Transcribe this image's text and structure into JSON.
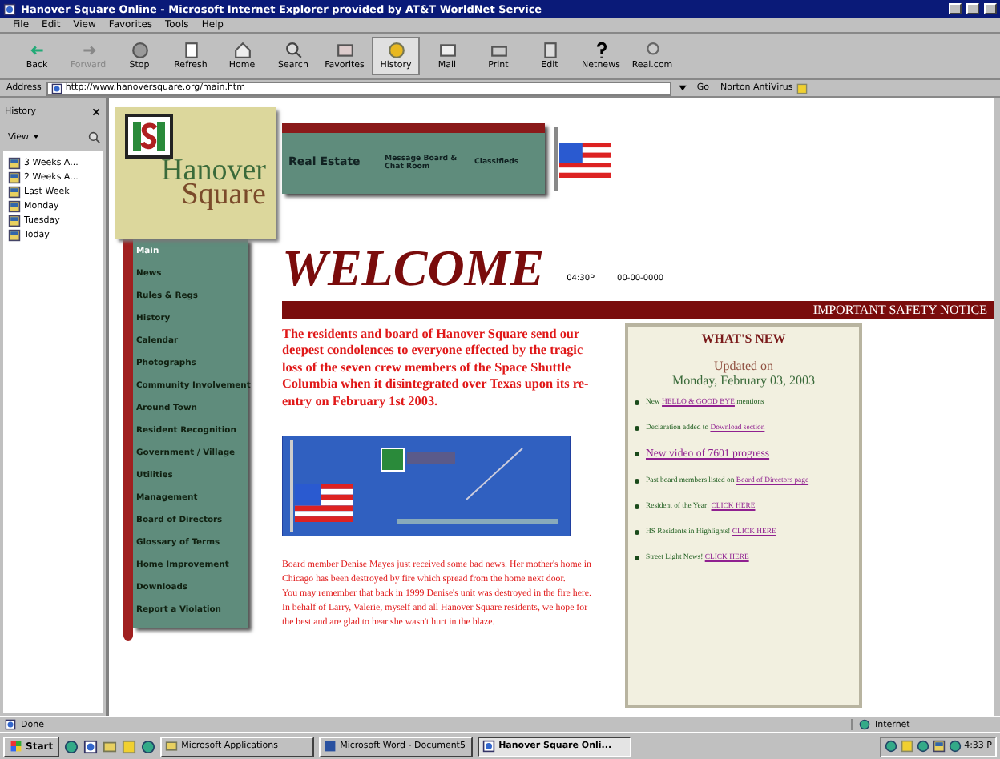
{
  "window": {
    "title": "Hanover Square Online - Microsoft Internet Explorer provided by AT&T WorldNet Service"
  },
  "menu": [
    "File",
    "Edit",
    "View",
    "Favorites",
    "Tools",
    "Help"
  ],
  "toolbar": [
    {
      "label": "Back",
      "kind": "back",
      "disabled": false,
      "selected": false
    },
    {
      "label": "Forward",
      "kind": "forward",
      "disabled": true,
      "selected": false
    },
    {
      "label": "Stop",
      "kind": "stop",
      "disabled": false,
      "selected": false
    },
    {
      "label": "Refresh",
      "kind": "refresh",
      "disabled": false,
      "selected": false
    },
    {
      "label": "Home",
      "kind": "home",
      "disabled": false,
      "selected": false
    },
    {
      "label": "Search",
      "kind": "search",
      "disabled": false,
      "selected": false
    },
    {
      "label": "Favorites",
      "kind": "favorites",
      "disabled": false,
      "selected": false
    },
    {
      "label": "History",
      "kind": "history",
      "disabled": false,
      "selected": true
    },
    {
      "label": "Mail",
      "kind": "mail",
      "disabled": false,
      "selected": false
    },
    {
      "label": "Print",
      "kind": "print",
      "disabled": false,
      "selected": false
    },
    {
      "label": "Edit",
      "kind": "edit",
      "disabled": false,
      "selected": false
    },
    {
      "label": "Netnews",
      "kind": "help",
      "disabled": false,
      "selected": false
    },
    {
      "label": "Real.com",
      "kind": "real",
      "disabled": false,
      "selected": false
    }
  ],
  "address": {
    "label": "Address",
    "value": "http://www.hanoversquare.org/main.htm",
    "go": "Go",
    "norton": "Norton AntiVirus"
  },
  "history_pane": {
    "title": "History",
    "view": "View",
    "items": [
      "3 Weeks A...",
      "2 Weeks A...",
      "Last Week",
      "Monday",
      "Tuesday",
      "Today"
    ]
  },
  "site": {
    "logo_top": "Hanover",
    "logo_bottom": "Square",
    "top_nav": [
      "Real Estate",
      "Message Board & Chat Room",
      "Classifieds"
    ],
    "nav": [
      {
        "label": "Main",
        "selected": true
      },
      {
        "label": "News",
        "selected": false
      },
      {
        "label": "Rules & Regs",
        "selected": false
      },
      {
        "label": "History",
        "selected": false
      },
      {
        "label": "Calendar",
        "selected": false
      },
      {
        "label": "Photographs",
        "selected": false
      },
      {
        "label": "Community Involvement",
        "selected": false
      },
      {
        "label": "Around Town",
        "selected": false
      },
      {
        "label": "Resident Recognition",
        "selected": false
      },
      {
        "label": "Government / Village",
        "selected": false
      },
      {
        "label": "Utilities",
        "selected": false
      },
      {
        "label": "Management",
        "selected": false
      },
      {
        "label": "Board of Directors",
        "selected": false
      },
      {
        "label": "Glossary of Terms",
        "selected": false
      },
      {
        "label": "Home Improvement",
        "selected": false
      },
      {
        "label": "Downloads",
        "selected": false
      },
      {
        "label": "Report a Violation",
        "selected": false
      }
    ],
    "welcome": "WELCOME",
    "time": "04:30P",
    "date": "00-00-0000",
    "notice": "IMPORTANT SAFETY NOTICE",
    "condolence": "The residents and board of Hanover Square send our deepest condolences to everyone effected by the tragic loss of the seven crew members of the Space Shuttle Columbia when it disintegrated over Texas upon its re-entry on February 1st 2003.",
    "news": [
      "Board member Denise Mayes just received some bad news. Her mother's home in Chicago has been destroyed by fire which spread from the home next door.",
      "You may remember that back in 1999 Denise's unit was destroyed in the fire here.",
      "In behalf of Larry, Valerie, myself and all Hanover Square residents, we hope for the best and are glad to hear she wasn't hurt in the blaze."
    ],
    "whats_new": {
      "title": "WHAT'S NEW",
      "updated": "Updated on",
      "date": "Monday, February 03, 2003",
      "items": [
        {
          "text": "New ",
          "link": "HELLO & GOOD BYE",
          "after": " mentions"
        },
        {
          "text": "Declaration added to ",
          "link": "Download section"
        },
        {
          "link": "New video of 7601 progress"
        },
        {
          "text": "Past board members listed on ",
          "link": "Board of Directors page"
        },
        {
          "text": "Resident of the Year! ",
          "link": "CLICK HERE"
        },
        {
          "text": "HS Residents in Highlights! ",
          "link": "CLICK HERE"
        },
        {
          "text": "Street Light News! ",
          "link": "CLICK HERE"
        }
      ]
    }
  },
  "status_bar": {
    "text": "Done",
    "zone": "Internet"
  },
  "taskbar": {
    "start": "Start",
    "tasks": [
      {
        "label": "Microsoft Applications",
        "selected": false
      },
      {
        "label": "Microsoft Word - Document5",
        "selected": false
      },
      {
        "label": "Hanover Square Onli...",
        "selected": true
      }
    ],
    "clock": "4:33 P"
  }
}
